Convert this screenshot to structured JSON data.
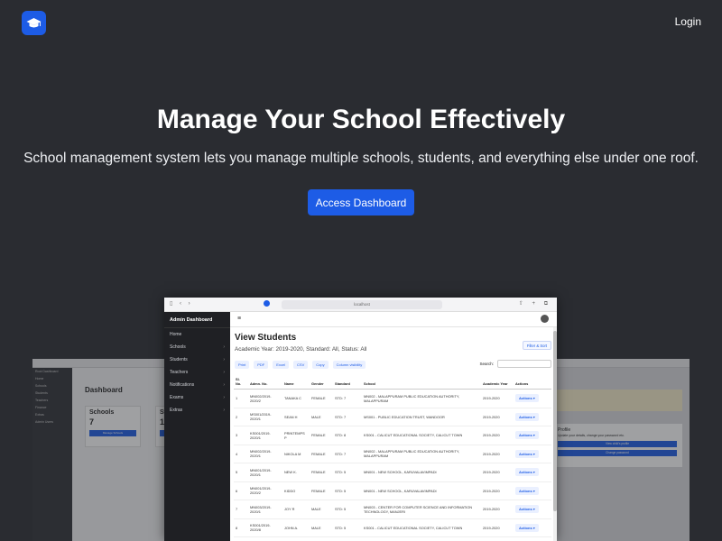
{
  "header": {
    "login_label": "Login"
  },
  "hero": {
    "title": "Manage Your School Effectively",
    "subtitle": "School management system lets you manage multiple schools, students, and everything else under one roof.",
    "cta_label": "Access Dashboard"
  },
  "colors": {
    "background": "#2a2c31",
    "accent": "#1d5ce6"
  },
  "preview": {
    "url": "localhost",
    "sidebar": {
      "brand": "Admin Dashboard",
      "items": [
        {
          "label": "Home",
          "icon": "home-icon"
        },
        {
          "label": "Schools",
          "icon": "school-icon"
        },
        {
          "label": "Students",
          "icon": "students-icon"
        },
        {
          "label": "Teachers",
          "icon": "teachers-icon"
        },
        {
          "label": "Notifications",
          "icon": "bell-icon"
        },
        {
          "label": "Exams",
          "icon": "exams-icon"
        },
        {
          "label": "Extras",
          "icon": "extras-icon"
        }
      ]
    },
    "title": "View Students",
    "subtitle": "Academic Year: 2019-2020, Standard: All, Status: All",
    "filter_label": "Filter & Sort",
    "tools": [
      "Print",
      "PDF",
      "Excel",
      "CSV",
      "Copy",
      "Column visibility"
    ],
    "search_label": "Search:",
    "columns": [
      "Sl. No.",
      "Admn. No.",
      "Name",
      "Gender",
      "Standard",
      "School",
      "Academic Year",
      "Actions"
    ],
    "rows": [
      [
        "1",
        "MN002/2019-2020/2",
        "TANAKA C",
        "FEMALE",
        "STD: 7",
        "MN002 - MALAPPURAM PUBLIC EDUCATION AUTHORITY, MALAPPURAM",
        "2019-2020",
        "Actions"
      ],
      [
        "2",
        "MS001/2019-2020/1",
        "SEAN H",
        "MALE",
        "STD: 7",
        "MS001 - PUBLIC EDUCATION TRUST, WANDOOR",
        "2019-2020",
        "Actions"
      ],
      [
        "3",
        "KS001/2019-2020/1",
        "PRINTEMPS P",
        "FEMALE",
        "STD: 8",
        "KS001 - CALICUT EDUCATIONAL SOCIETY, CALICUT TOWN",
        "2019-2020",
        "Actions"
      ],
      [
        "4",
        "MN002/2019-2020/1",
        "NIKOLA M",
        "FEMALE",
        "STD: 7",
        "MN002 - MALAPPURAM PUBLIC EDUCATION AUTHORITY, MALAPPURAM",
        "2019-2020",
        "Actions"
      ],
      [
        "5",
        "MN001/2019-2020/1",
        "NEW K.",
        "FEMALE",
        "STD: 5",
        "MN001 - NEW SCHOOL, KARUVALAVIMPADI",
        "2019-2020",
        "Actions"
      ],
      [
        "6",
        "MN001/2019-2020/2",
        "KIDDO",
        "FEMALE",
        "STD: 5",
        "MN001 - NEW SCHOOL, KARUVALAVIMPADI",
        "2019-2020",
        "Actions"
      ],
      [
        "7",
        "MN003/2019-2020/1",
        "JOY R",
        "MALE",
        "STD: 5",
        "MN003 - CENTER FOR COMPUTER SCIENCE AND INFORMATION TECHNOLOGY, MANJERI",
        "2019-2020",
        "Actions"
      ],
      [
        "8",
        "KS001/2019-2020/8",
        "JOHN A.",
        "MALE",
        "STD: 5",
        "KS001 - CALICUT EDUCATIONAL SOCIETY, CALICUT TOWN",
        "2019-2020",
        "Actions"
      ]
    ]
  },
  "bg_left": {
    "brand": "Root Dashboard",
    "sidebar": [
      "Home",
      "Schools",
      "Students",
      "Teachers",
      "Finance",
      "Extras",
      "Admin Users"
    ],
    "heading": "Dashboard",
    "card1_title": "Schools",
    "card1_value": "7",
    "card1_button": "Manage Schools",
    "card2_title": "Stu",
    "card2_value": "10"
  },
  "bg_right": {
    "card_title": "Profile",
    "card_text": "Update your details, change your password etc.",
    "button1": "View child's profile",
    "button2": "Change password"
  }
}
